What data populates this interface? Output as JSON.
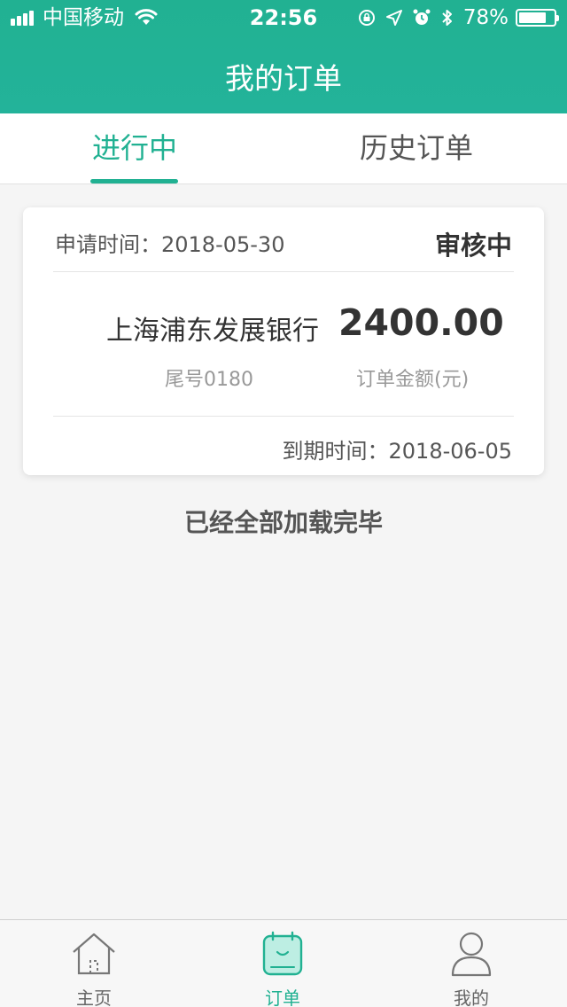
{
  "status_bar": {
    "carrier": "中国移动",
    "time": "22:56",
    "battery_percent": "78%",
    "battery_level": 0.78
  },
  "nav": {
    "title": "我的订单"
  },
  "tabs": [
    {
      "label": "进行中",
      "active": true
    },
    {
      "label": "历史订单",
      "active": false
    }
  ],
  "order": {
    "apply_time": "申请时间：2018-05-30",
    "status": "审核中",
    "bank_name": "上海浦东发展银行",
    "amount": "2400.00",
    "tail_no": "尾号0180",
    "amount_label": "订单金额(元)",
    "due_time": "到期时间：2018-06-05"
  },
  "list_footer": "已经全部加载完毕",
  "tabbar": [
    {
      "label": "主页",
      "icon": "home-icon",
      "active": false
    },
    {
      "label": "订单",
      "icon": "order-icon",
      "active": true
    },
    {
      "label": "我的",
      "icon": "user-icon",
      "active": false
    }
  ],
  "colors": {
    "accent": "#21b192",
    "background": "#f5f5f5"
  }
}
